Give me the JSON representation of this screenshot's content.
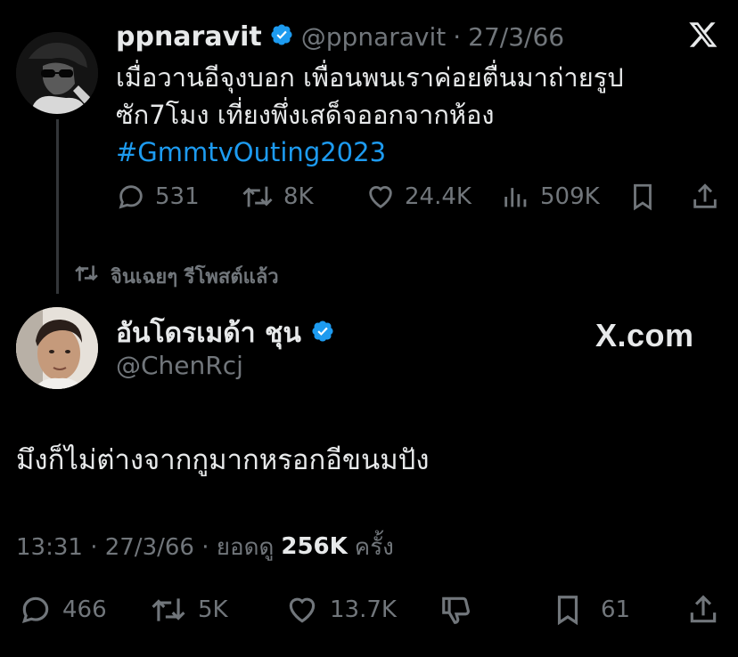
{
  "quoted_tweet": {
    "display_name": "ppnaravit",
    "handle": "@ppnaravit",
    "separator": "·",
    "date": "27/3/66",
    "text_line1": "เมื่อวานอีจุงบอก เพื่อนพนเราค่อยตื่นมาถ่ายรูป",
    "text_line2": "ซัก7โมง เที่ยงพึ่งเสด็จออกจากห้อง",
    "hashtag": "#GmmtvOuting2023",
    "stats": {
      "replies": "531",
      "reposts": "8K",
      "likes": "24.4K",
      "views": "509K"
    }
  },
  "repost_label": "จินเฉยๆ รีโพสต์แล้ว",
  "main_tweet": {
    "display_name": "อันโดรเมด้า ชุน",
    "handle": "@ChenRcj",
    "text": "มึงก็ไม่ต่างจากกูมากหรอกอีขนมปัง",
    "timestamp": "13:31 · 27/3/66 · ยอดดู",
    "views_bold": "256K",
    "views_suffix": "ครั้ง",
    "stats": {
      "replies": "466",
      "reposts": "5K",
      "likes": "13.7K",
      "bookmarks": "61"
    }
  },
  "watermark": "X.com",
  "colors": {
    "background": "#000000",
    "text": "#e7e9ea",
    "muted": "#71767b",
    "accent": "#1d9bf0"
  },
  "icons": [
    "x-logo-icon",
    "verified-badge-icon",
    "reply-icon",
    "repost-icon",
    "like-icon",
    "views-icon",
    "bookmark-icon",
    "share-icon",
    "dislike-icon"
  ]
}
